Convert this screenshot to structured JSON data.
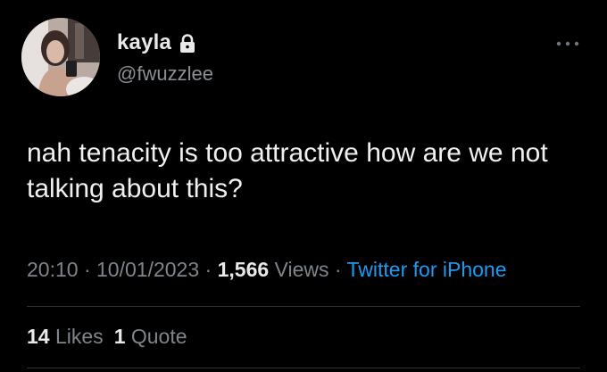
{
  "user": {
    "display_name": "kayla",
    "handle": "@fwuzzlee",
    "protected_icon": "lock-icon",
    "avatar_icon": "profile-photo"
  },
  "more_icon": "more-horizontal-icon",
  "tweet": {
    "text": "nah tenacity is too attractive how are we not talking about this?"
  },
  "meta": {
    "time": "20:10",
    "separator": " · ",
    "date": "10/01/2023",
    "views_count": "1,566",
    "views_label": "Views",
    "source": "Twitter for iPhone"
  },
  "stats": {
    "likes_count": "14",
    "likes_label": "Likes",
    "quotes_count": "1",
    "quotes_label": "Quote"
  },
  "colors": {
    "background": "#000000",
    "primary_text": "#e7e9ea",
    "secondary_text": "#7f858a",
    "link": "#1d9bf0",
    "divider": "#2f3336"
  }
}
